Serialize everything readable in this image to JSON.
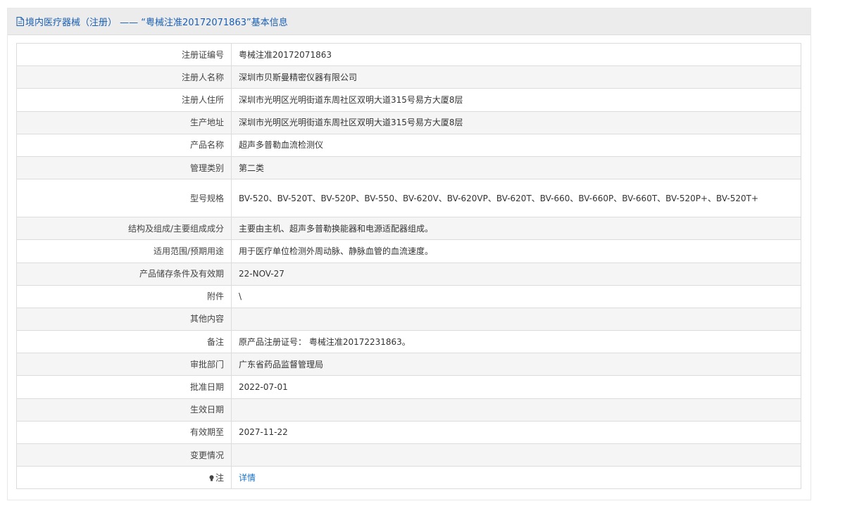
{
  "header": {
    "title": "境内医疗器械（注册） —— “粤械注准20172071863”基本信息"
  },
  "rows": [
    {
      "label": "注册证编号",
      "value": "粤械注准20172071863"
    },
    {
      "label": "注册人名称",
      "value": "深圳市贝斯曼精密仪器有限公司"
    },
    {
      "label": "注册人住所",
      "value": "深圳市光明区光明街道东周社区双明大道315号易方大厦8层"
    },
    {
      "label": "生产地址",
      "value": "深圳市光明区光明街道东周社区双明大道315号易方大厦8层"
    },
    {
      "label": "产品名称",
      "value": "超声多普勒血流检测仪"
    },
    {
      "label": "管理类别",
      "value": "第二类"
    },
    {
      "label": "型号规格",
      "value": "BV-520、BV-520T、BV-520P、BV-550、BV-620V、BV-620VP、BV-620T、BV-660、BV-660P、BV-660T、BV-520P+、BV-520T+"
    },
    {
      "label": "结构及组成/主要组成成分",
      "value": "主要由主机、超声多普勒换能器和电源适配器组成。"
    },
    {
      "label": "适用范围/预期用途",
      "value": "用于医疗单位检测外周动脉、静脉血管的血流速度。"
    },
    {
      "label": "产品储存条件及有效期",
      "value": "22-NOV-27"
    },
    {
      "label": "附件",
      "value": "\\"
    },
    {
      "label": "其他内容",
      "value": ""
    },
    {
      "label": "备注",
      "value": "原产品注册证号： 粤械注准20172231863。"
    },
    {
      "label": "审批部门",
      "value": "广东省药品监督管理局"
    },
    {
      "label": "批准日期",
      "value": "2022-07-01"
    },
    {
      "label": "生效日期",
      "value": ""
    },
    {
      "label": "有效期至",
      "value": "2027-11-22"
    },
    {
      "label": "变更情况",
      "value": ""
    },
    {
      "label": "注",
      "value": "详情"
    }
  ],
  "colors": {
    "link": "#1a72c8",
    "header_text": "#1a5fb4"
  },
  "icons": {
    "header": "document-icon",
    "note": "lightbulb-icon"
  }
}
